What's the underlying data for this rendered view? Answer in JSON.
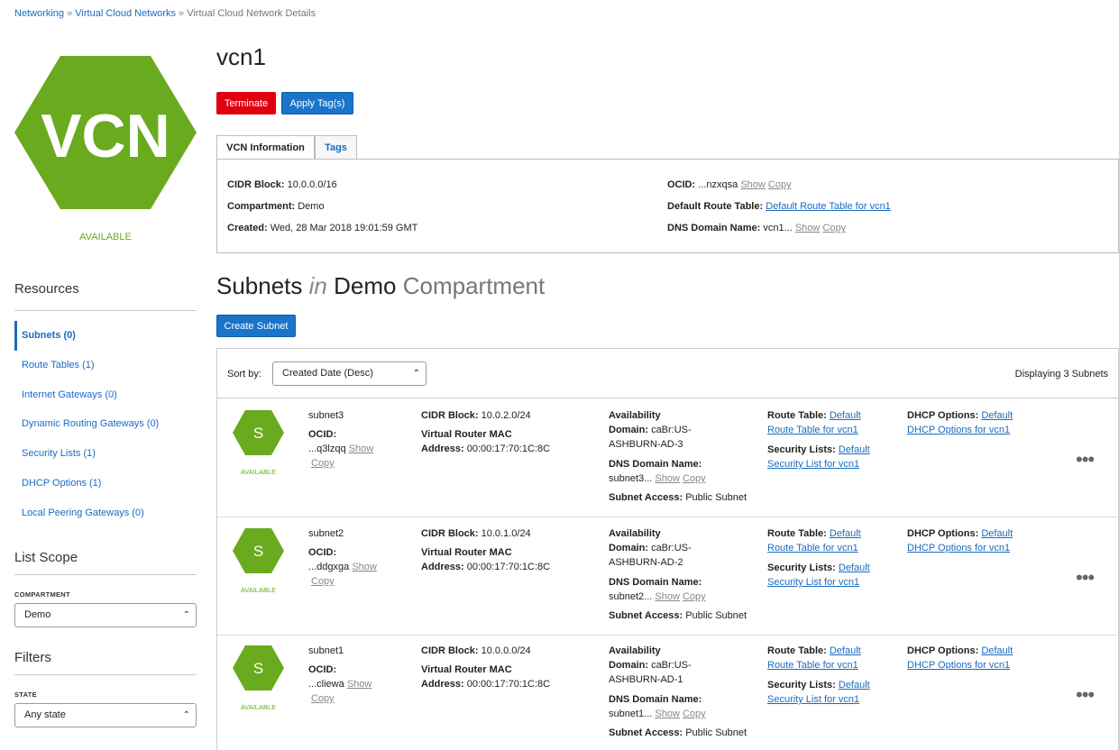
{
  "breadcrumb": {
    "networking": "Networking",
    "sep": "»",
    "vcns": "Virtual Cloud Networks",
    "current": "Virtual Cloud Network Details"
  },
  "vcn": {
    "icon_text": "VCN",
    "status": "AVAILABLE",
    "name": "vcn1"
  },
  "actions": {
    "terminate": "Terminate",
    "apply_tags": "Apply Tag(s)"
  },
  "tabs": {
    "info": "VCN Information",
    "tags": "Tags"
  },
  "info": {
    "cidr_label": "CIDR Block:",
    "cidr": "10.0.0.0/16",
    "compartment_label": "Compartment:",
    "compartment": "Demo",
    "created_label": "Created:",
    "created": "Wed, 28 Mar 2018 19:01:59 GMT",
    "ocid_label": "OCID:",
    "ocid": "...nzxqsa",
    "route_label": "Default Route Table:",
    "route": "Default Route Table for vcn1",
    "dns_label": "DNS Domain Name:",
    "dns": "vcn1...",
    "show": "Show",
    "copy": "Copy"
  },
  "sidebar": {
    "resources_title": "Resources",
    "items": [
      {
        "label": "Subnets (0)"
      },
      {
        "label": "Route Tables (1)"
      },
      {
        "label": "Internet Gateways (0)"
      },
      {
        "label": "Dynamic Routing Gateways (0)"
      },
      {
        "label": "Security Lists (1)"
      },
      {
        "label": "DHCP Options (1)"
      },
      {
        "label": "Local Peering Gateways (0)"
      }
    ],
    "scope_title": "List Scope",
    "compartment_caption": "COMPARTMENT",
    "compartment_value": "Demo",
    "filters_title": "Filters",
    "state_caption": "STATE",
    "state_value": "Any state"
  },
  "subnets": {
    "title_main": "Subnets",
    "title_in": "in",
    "title_comp": "Demo",
    "title_suffix": "Compartment",
    "create": "Create Subnet",
    "sort_label": "Sort by:",
    "sort_value": "Created Date (Desc)",
    "displaying": "Displaying 3 Subnets",
    "labels": {
      "ocid": "OCID:",
      "cidr": "CIDR Block:",
      "vr_mac_1": "Virtual Router MAC",
      "vr_mac_2": "Address:",
      "availability": "Availability",
      "domain": "Domain:",
      "dns": "DNS Domain Name:",
      "access": "Subnet Access:",
      "route": "Route Table:",
      "security": "Security Lists:",
      "dhcp": "DHCP Options:",
      "show": "Show",
      "copy": "Copy",
      "available": "AVAILABLE",
      "icon": "S",
      "more": "•••"
    },
    "rows": [
      {
        "name": "subnet3",
        "ocid": "...q3lzqq",
        "cidr": "10.0.2.0/24",
        "mac": "00:00:17:70:1C:8C",
        "domain_1": "caBr:US-",
        "domain_2": "ASHBURN-AD-3",
        "dns": "subnet3...",
        "access": "Public Subnet",
        "route_link": "Default",
        "route_full": "Route Table for vcn1",
        "sec_link": "Default",
        "sec_full": "Security List for vcn1",
        "dhcp_link": "Default",
        "dhcp_full": "DHCP Options for vcn1"
      },
      {
        "name": "subnet2",
        "ocid": "...ddgxga",
        "cidr": "10.0.1.0/24",
        "mac": "00:00:17:70:1C:8C",
        "domain_1": "caBr:US-",
        "domain_2": "ASHBURN-AD-2",
        "dns": "subnet2...",
        "access": "Public Subnet",
        "route_link": "Default",
        "route_full": "Route Table for vcn1",
        "sec_link": "Default",
        "sec_full": "Security List for vcn1",
        "dhcp_link": "Default",
        "dhcp_full": "DHCP Options for vcn1"
      },
      {
        "name": "subnet1",
        "ocid": "...cliewa",
        "cidr": "10.0.0.0/24",
        "mac": "00:00:17:70:1C:8C",
        "domain_1": "caBr:US-",
        "domain_2": "ASHBURN-AD-1",
        "dns": "subnet1...",
        "access": "Public Subnet",
        "route_link": "Default",
        "route_full": "Route Table for vcn1",
        "sec_link": "Default",
        "sec_full": "Security List for vcn1",
        "dhcp_link": "Default",
        "dhcp_full": "DHCP Options for vcn1"
      }
    ]
  },
  "colors": {
    "hex_green": "#6aaa1e",
    "link_blue": "#1a6bbf",
    "danger": "#e1000f",
    "primary": "#1a74c9"
  }
}
